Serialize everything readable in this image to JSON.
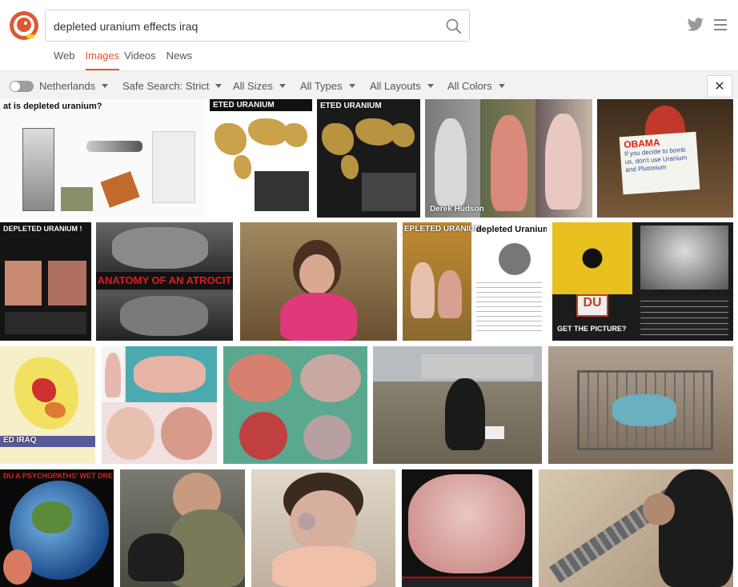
{
  "search": {
    "query": "depleted uranium effects iraq"
  },
  "tabs": [
    {
      "label": "Web"
    },
    {
      "label": "Images",
      "active": true
    },
    {
      "label": "Videos"
    },
    {
      "label": "News"
    }
  ],
  "filters": {
    "region": "Netherlands",
    "safe_search": "Safe Search: Strict",
    "size": "All Sizes",
    "type": "All Types",
    "layout": "All Layouts",
    "color": "All Colors"
  },
  "colors": {
    "accent": "#de5833",
    "filterbar": "#f2f2f2"
  },
  "icons": {
    "search": "search-icon",
    "twitter": "twitter-icon",
    "menu": "hamburger-icon",
    "close": "close-icon"
  },
  "results": {
    "r1": {
      "cap": "at is depleted uranium?"
    },
    "r2": {
      "cap": "ETED URANIUM"
    },
    "r3": {
      "cap": "ETED URANIUM"
    },
    "r4": {
      "cap": "Derek Hudson"
    },
    "r5": {
      "cap": "OBAMA",
      "sign": "If you decide to bomb us, don't use Uranium and Plutonium"
    },
    "r6": {
      "cap": "DEPLETED URANIUM !"
    },
    "r7": {
      "cap": "ANATOMY OF AN ATROCIT"
    },
    "r9": {
      "cap": "EPLETED URANIUM"
    },
    "r10": {
      "cap": "depleted Uranium"
    },
    "r11": {
      "cap": "DU",
      "sub": "GET THE PICTURE?"
    },
    "r12": {
      "cap": "ED IRAQ"
    },
    "r17": {
      "cap": "DU  A PSYCHOPATHS' WET DREAM"
    }
  }
}
